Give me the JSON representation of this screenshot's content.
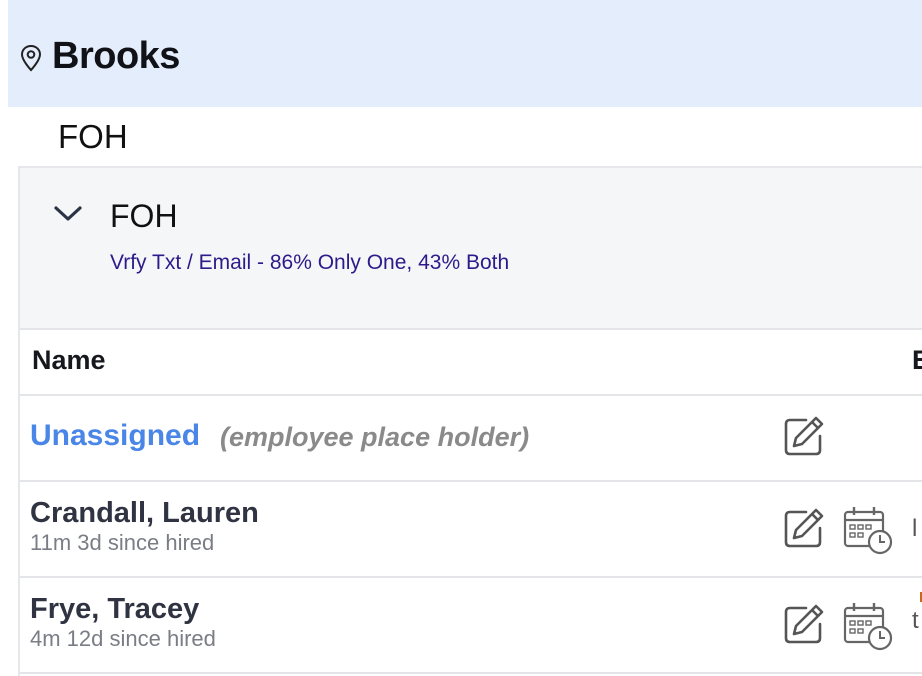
{
  "header": {
    "location_icon": "location-pin-icon",
    "title": "Brooks"
  },
  "section": {
    "label": "FOH"
  },
  "group": {
    "expand_icon": "chevron-down-icon",
    "title": "FOH",
    "subtitle": "Vrfy Txt / Email - 86% Only One, 43% Both"
  },
  "table": {
    "columns": [
      "Name",
      "E"
    ],
    "rows": [
      {
        "name": "Unassigned",
        "note": "(employee place holder)",
        "icons": [
          "edit-icon"
        ]
      },
      {
        "name": "Crandall, Lauren",
        "tenure": "11m 3d since hired",
        "icons": [
          "edit-icon",
          "schedule-calendar-icon"
        ],
        "trailing": "l"
      },
      {
        "name": "Frye, Tracey",
        "tenure": "4m 12d since hired",
        "icons": [
          "edit-icon",
          "schedule-calendar-icon"
        ],
        "trailing": "t"
      }
    ]
  }
}
